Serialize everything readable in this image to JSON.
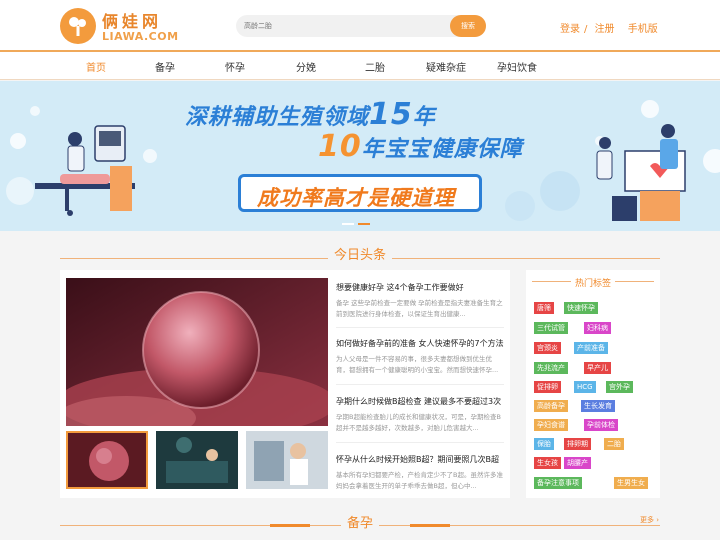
{
  "header": {
    "logo_text": "俩娃网",
    "logo_sub": "LIAWA.COM",
    "search_placeholder": "高龄二胎",
    "search_button": "搜索",
    "login": "登录",
    "separator": "/",
    "register": "注册",
    "mobile": "手机版"
  },
  "nav": {
    "items": [
      {
        "label": "首页",
        "active": true
      },
      {
        "label": "备孕"
      },
      {
        "label": "怀孕"
      },
      {
        "label": "分娩"
      },
      {
        "label": "二胎"
      },
      {
        "label": "疑难杂症"
      },
      {
        "label": "孕妇饮食"
      }
    ]
  },
  "banner": {
    "line1_pre": "深耕辅助生殖领域",
    "line1_num": "15",
    "line1_post": "年",
    "line2_num": "10",
    "line2_post": "年宝宝健康保障",
    "slogan": "成功率高才是硬道理"
  },
  "today": {
    "title": "今日头条",
    "articles": [
      {
        "title": "想要健康好孕 这4个备孕工作要做好",
        "excerpt": "备孕 这些孕前检查一定要做 孕前检查是指夫妻准备生育之前到医院进行身体检查，以保证生育出健康..."
      },
      {
        "title": "如何做好备孕前的准备 女人快速怀孕的7个方法",
        "excerpt": "为人父母是一件不容易的事，很多夫妻都想做到优生优育，都想拥有一个健康聪明的小宝宝。然而想快速怀孕..."
      },
      {
        "title": "孕期什么时候做B超检查 建议最多不要超过3次",
        "excerpt": "孕期B超能检查胎儿的成长和健康状况，可是，孕期检查B超并不是越多越好，次数越多，对胎儿危害越大..."
      },
      {
        "title": "怀孕从什么时候开始照B超？期间要照几次B超",
        "excerpt": "基本所有孕妇都要产检，产检肯定少不了B超。虽然许多准妈妈会拿着医生开的单子乖乖去做B超，但心中..."
      }
    ]
  },
  "tags": {
    "title": "热门标签",
    "items": [
      {
        "label": "唐筛",
        "color": "#e64545"
      },
      {
        "label": "快速怀孕",
        "color": "#5cb85c"
      },
      {
        "label": "三代试管",
        "color": "#5cb85c"
      },
      {
        "label": "妇科病",
        "color": "#d946c9"
      },
      {
        "label": "宫颈炎",
        "color": "#e64545"
      },
      {
        "label": "产前准备",
        "color": "#5cb5e8"
      },
      {
        "label": "先兆流产",
        "color": "#5cb85c"
      },
      {
        "label": "早产儿",
        "color": "#e64545"
      },
      {
        "label": "促排卵",
        "color": "#e64545"
      },
      {
        "label": "HCG",
        "color": "#5cb5e8"
      },
      {
        "label": "宫外孕",
        "color": "#5cb85c"
      },
      {
        "label": "高龄备孕",
        "color": "#f0ad4e"
      },
      {
        "label": "生长发育",
        "color": "#5b7ee0"
      },
      {
        "label": "孕妇食谱",
        "color": "#f0ad4e"
      },
      {
        "label": "孕前体检",
        "color": "#d946c9"
      },
      {
        "label": "保胎",
        "color": "#5cb5e8"
      },
      {
        "label": "排卵期",
        "color": "#e64545"
      },
      {
        "label": "二胎",
        "color": "#f0ad4e"
      },
      {
        "label": "生女孩",
        "color": "#e64545"
      },
      {
        "label": "胡腰产",
        "color": "#d946c9"
      },
      {
        "label": "备孕注意事项",
        "color": "#5cb85c"
      },
      {
        "label": "生男生女",
        "color": "#f0ad4e"
      }
    ]
  },
  "section2": {
    "title": "备孕",
    "more": "更多"
  },
  "colors": {
    "accent": "#f08a2c",
    "banner_bg": "#d3ebf7",
    "banner_blue": "#2b7fd6"
  }
}
